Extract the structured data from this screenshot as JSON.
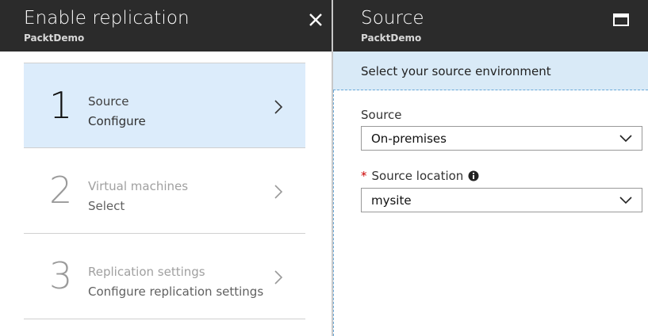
{
  "left_blade": {
    "title": "Enable replication",
    "subtitle": "PacktDemo",
    "close_icon": "close-icon",
    "steps": [
      {
        "number": "1",
        "title": "Source",
        "subtitle": "Configure",
        "state": "active"
      },
      {
        "number": "2",
        "title": "Virtual machines",
        "subtitle": "Select",
        "state": "inactive"
      },
      {
        "number": "3",
        "title": "Replication settings",
        "subtitle": "Configure replication settings",
        "state": "inactive"
      }
    ]
  },
  "right_blade": {
    "title": "Source",
    "subtitle": "PacktDemo",
    "banner": "Select your source environment",
    "source": {
      "label": "Source",
      "value": "On-premises"
    },
    "source_location": {
      "label": "Source location",
      "required_mark": "*",
      "value": "mysite"
    }
  },
  "colors": {
    "header_bg": "#2b2b2b",
    "active_step_bg": "#dcecfb",
    "banner_bg": "#d9eaf7",
    "required_star": "#cc0000"
  }
}
